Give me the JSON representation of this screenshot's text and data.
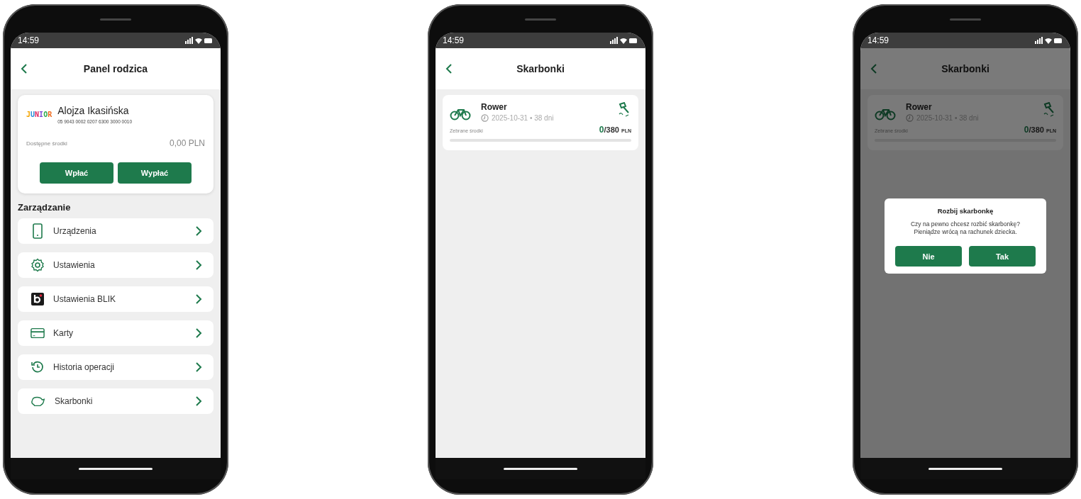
{
  "phones": [
    {
      "kind": "panel",
      "status_time": "14:59",
      "title": "Panel rodzica",
      "account": {
        "logo": "JUNIOR",
        "name": "Alojza Ikasińska",
        "number": "05 9043 0002 0207 6300 3000 0010",
        "balance_label": "Dostępne środki",
        "balance": "0,00 PLN"
      },
      "buttons": [
        "Wpłać",
        "Wypłać"
      ],
      "section_title": "Zarządzanie",
      "menu": [
        {
          "kind": "phone",
          "label": "Urządzenia"
        },
        {
          "kind": "gear",
          "label": "Ustawienia"
        },
        {
          "kind": "blik",
          "label": "Ustawienia BLIK"
        },
        {
          "kind": "card",
          "label": "Karty"
        },
        {
          "kind": "history",
          "label": "Historia operacji"
        },
        {
          "kind": "piggy",
          "label": "Skarbonki"
        }
      ]
    },
    {
      "kind": "goals",
      "status_time": "14:59",
      "title": "Skarbonki",
      "dimmed": false,
      "goals": [
        {
          "name": "Rower",
          "date": "2025-10-31 • 38 dni",
          "collected_label": "Zebrane środki",
          "collected": "0",
          "target": "/380",
          "currency": "PLN",
          "level": 0
        }
      ]
    },
    {
      "kind": "goals",
      "status_time": "14:59",
      "title": "Skarbonki",
      "dimmed": true,
      "goals": [
        {
          "name": "Rower",
          "date": "2025-10-31 • 38 dni",
          "collected_label": "Zebrane środki",
          "collected": "0",
          "target": "/380",
          "currency": "PLN",
          "level": 0
        }
      ],
      "dialog": {
        "title": "Rozbij skarbonkę",
        "message": [
          "Czy na pewno chcesz rozbić skarbonkę?",
          "Pieniądze wrócą na rachunek dziecka."
        ],
        "buttons": [
          "Nie",
          "Tak"
        ]
      }
    }
  ]
}
